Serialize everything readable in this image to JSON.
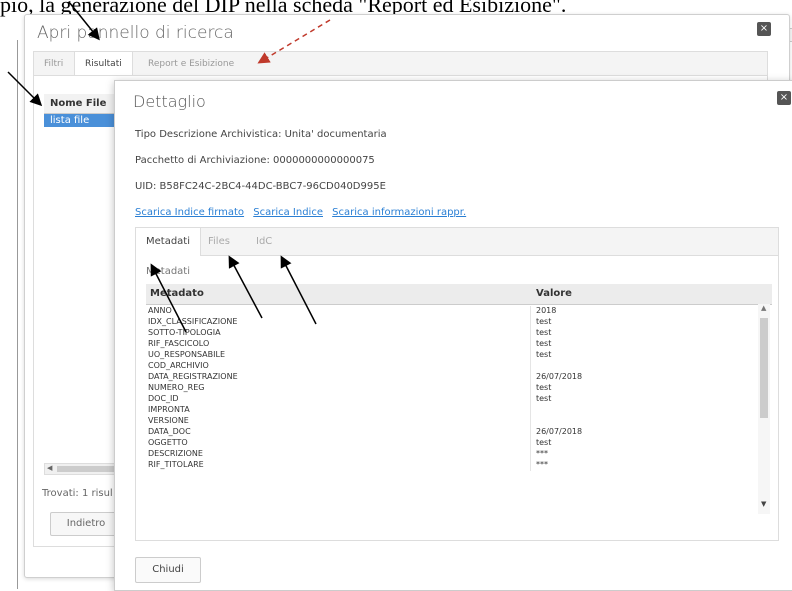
{
  "doc_caption": "pio, la generazione del DIP nella scheda \"Report ed Esibizione\".",
  "outer_panel": {
    "title": "Apri pannello di ricerca",
    "close_symbol": "×",
    "tabs": [
      "Filtri",
      "Risultati",
      "Report e Esibizione"
    ],
    "active_tab": "Risultati",
    "file_table": {
      "header": "Nome File",
      "rows": [
        "lista file"
      ]
    },
    "found_text": "Trovati: 1 risul",
    "back_button": "Indietro"
  },
  "detail": {
    "title": "Dettaglio",
    "close_symbol": "×",
    "tipo_descrizione": "Tipo Descrizione Archivistica: Unita' documentaria",
    "pacchetto": "Pacchetto di Archiviazione: 0000000000000075",
    "uid": "UID: B58FC24C-2BC4-44DC-BBC7-96CD040D995E",
    "links": [
      "Scarica Indice firmato",
      "Scarica Indice",
      "Scarica informazioni rappr."
    ],
    "tabs": [
      "Metadati",
      "Files",
      "IdC"
    ],
    "active_tab": "Metadati",
    "section_label": "Metadati",
    "columns": [
      "Metadato",
      "Valore"
    ],
    "rows": [
      {
        "key": "ANNO",
        "value": "2018"
      },
      {
        "key": "IDX_CLASSIFICAZIONE",
        "value": "test"
      },
      {
        "key": "SOTTO-TIPOLOGIA",
        "value": "test"
      },
      {
        "key": "RIF_FASCICOLO",
        "value": "test"
      },
      {
        "key": "UO_RESPONSABILE",
        "value": "test"
      },
      {
        "key": "COD_ARCHIVIO",
        "value": ""
      },
      {
        "key": "DATA_REGISTRAZIONE",
        "value": "26/07/2018"
      },
      {
        "key": "NUMERO_REG",
        "value": "test"
      },
      {
        "key": "DOC_ID",
        "value": "test"
      },
      {
        "key": "IMPRONTA",
        "value": ""
      },
      {
        "key": "VERSIONE",
        "value": ""
      },
      {
        "key": "DATA_DOC",
        "value": "26/07/2018"
      },
      {
        "key": "OGGETTO",
        "value": "test"
      },
      {
        "key": "DESCRIZIONE",
        "value": "***"
      },
      {
        "key": "RIF_TITOLARE",
        "value": "***"
      }
    ],
    "close_button": "Chiudi"
  },
  "annotation_colors": {
    "black_arrow": "#000000",
    "red_arrow": "#c0392b"
  },
  "selection_color": "#4a90d9",
  "link_color": "#2a7fd4"
}
